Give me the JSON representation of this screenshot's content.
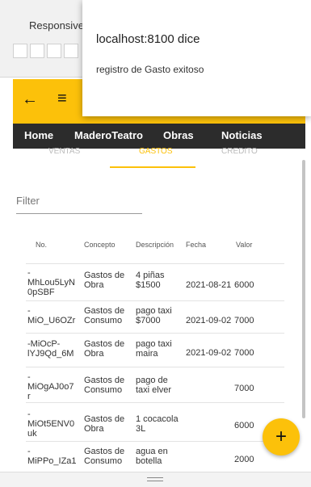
{
  "devtools": {
    "responsive_label": "Responsive"
  },
  "header": {
    "back_icon": "arrow-left-icon",
    "menu_icon": "menu-icon"
  },
  "nav": {
    "items": [
      "Home",
      "MaderoTeatro",
      "Obras",
      "Noticias"
    ]
  },
  "tabs": {
    "items": [
      "VENTAS",
      "GASTOS",
      "CREDITO"
    ],
    "active": "GASTOS"
  },
  "filter": {
    "placeholder": "Filter",
    "value": ""
  },
  "table": {
    "headers": [
      "No.",
      "Concepto",
      "Descripción",
      "Fecha",
      "Valor"
    ],
    "rows": [
      {
        "no": "-\nMhLou5LyN\n0pSBF",
        "concepto": "Gastos de\nObra",
        "descripcion": "4 piñas\n$1500",
        "fecha": "2021-08-21",
        "valor": "6000"
      },
      {
        "no": "-\nMiO_U6OZr",
        "concepto": "Gastos de\nConsumo",
        "descripcion": "pago taxi\n$7000",
        "fecha": "2021-09-02",
        "valor": "7000"
      },
      {
        "no": "-MiOcP-\nlYJ9Qd_6M",
        "concepto": "Gastos de\nObra",
        "descripcion": "pago taxi\nmaira",
        "fecha": "2021-09-02",
        "valor": "7000"
      },
      {
        "no": "-\nMiOgAJ0o7\nr",
        "concepto": "Gastos de\nConsumo",
        "descripcion": "pago de\ntaxi elver",
        "fecha": "",
        "valor": "7000"
      },
      {
        "no": "-\nMiOt5ENV0\nuk",
        "concepto": "Gastos de\nObra",
        "descripcion": "1 cocacola\n3L",
        "fecha": "",
        "valor": "6000"
      },
      {
        "no": "-\nMiPPo_IZa1",
        "concepto": "Gastos de\nConsumo",
        "descripcion": "agua en\nbotella",
        "fecha": "",
        "valor": "2000"
      }
    ]
  },
  "fab": {
    "icon": "plus-icon",
    "label": "+"
  },
  "alert": {
    "title": "localhost:8100 dice",
    "message": "registro de Gasto exitoso"
  }
}
